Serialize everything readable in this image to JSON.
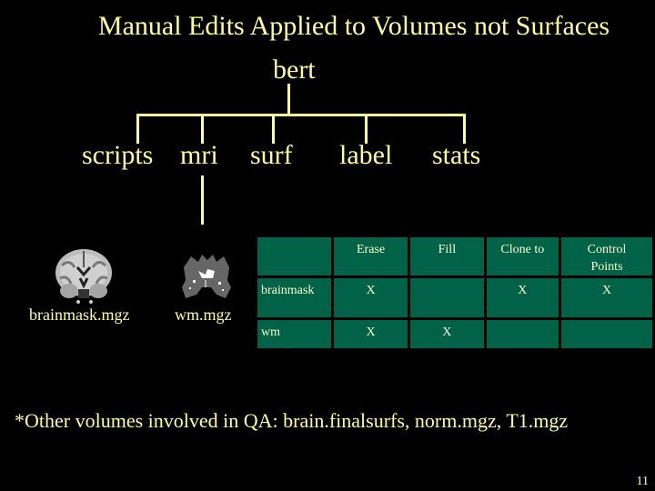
{
  "slide": {
    "title": "Manual Edits Applied to Volumes not Surfaces",
    "page_number": "11",
    "colors": {
      "background": "#000000",
      "text": "#ffff99",
      "table_cell": "#006347"
    }
  },
  "tree": {
    "root": "bert",
    "children": [
      "scripts",
      "mri",
      "surf",
      "label",
      "stats"
    ]
  },
  "images": [
    {
      "label": "brainmask.mgz",
      "icon": "brain-coronal-slice-icon"
    },
    {
      "label": "wm.mgz",
      "icon": "white-matter-slice-icon"
    }
  ],
  "table": {
    "headers": [
      "",
      "Erase",
      "Fill",
      "Clone to",
      "Control Points"
    ],
    "rows": [
      {
        "label": "brainmask",
        "cells": [
          "X",
          "",
          "X",
          "X"
        ]
      },
      {
        "label": "wm",
        "cells": [
          "X",
          "X",
          "",
          ""
        ]
      }
    ]
  },
  "footnote": "*Other volumes involved in QA: brain.finalsurfs, norm.mgz, T1.mgz"
}
